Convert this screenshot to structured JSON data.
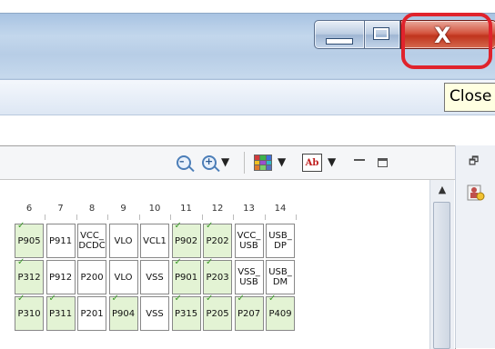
{
  "window": {
    "close_symbol": "X",
    "tooltip": "Close"
  },
  "toolbar": {
    "zoom_out_icon": "zoom-out-icon",
    "zoom_in_icon": "zoom-in-icon",
    "dropdown_arrow": "▼",
    "font_icon_text": "Ab"
  },
  "grid": {
    "columns": [
      "6",
      "7",
      "8",
      "9",
      "10",
      "11",
      "12",
      "13",
      "14"
    ],
    "rows": [
      [
        {
          "label": "P905",
          "green": true,
          "checked": true
        },
        {
          "label": "P911",
          "green": false,
          "checked": false
        },
        {
          "label": "VCC_\nDCDC",
          "green": false,
          "checked": false
        },
        {
          "label": "VLO",
          "green": false,
          "checked": false
        },
        {
          "label": "VCL1",
          "green": false,
          "checked": false
        },
        {
          "label": "P902",
          "green": true,
          "checked": true
        },
        {
          "label": "P202",
          "green": true,
          "checked": true
        },
        {
          "label": "VCC_\nUSB",
          "green": false,
          "checked": false
        },
        {
          "label": "USB_\nDP",
          "green": false,
          "checked": false
        }
      ],
      [
        {
          "label": "P312",
          "green": true,
          "checked": true
        },
        {
          "label": "P912",
          "green": false,
          "checked": false
        },
        {
          "label": "P200",
          "green": false,
          "checked": false
        },
        {
          "label": "VLO",
          "green": false,
          "checked": false
        },
        {
          "label": "VSS",
          "green": false,
          "checked": false
        },
        {
          "label": "P901",
          "green": true,
          "checked": true
        },
        {
          "label": "P203",
          "green": true,
          "checked": true
        },
        {
          "label": "VSS_\nUSB",
          "green": false,
          "checked": false
        },
        {
          "label": "USB_\nDM",
          "green": false,
          "checked": false
        }
      ],
      [
        {
          "label": "P310",
          "green": true,
          "checked": true
        },
        {
          "label": "P311",
          "green": true,
          "checked": true
        },
        {
          "label": "P201",
          "green": false,
          "checked": false
        },
        {
          "label": "P904",
          "green": true,
          "checked": true
        },
        {
          "label": "VSS",
          "green": false,
          "checked": false
        },
        {
          "label": "P315",
          "green": true,
          "checked": true
        },
        {
          "label": "P205",
          "green": true,
          "checked": true
        },
        {
          "label": "P207",
          "green": true,
          "checked": true
        },
        {
          "label": "P409",
          "green": true,
          "checked": true
        }
      ]
    ]
  },
  "colors": {
    "accent_close": "#c0341d",
    "highlight_ring": "#e0232c",
    "pin_assigned": "#e3f3d4"
  }
}
